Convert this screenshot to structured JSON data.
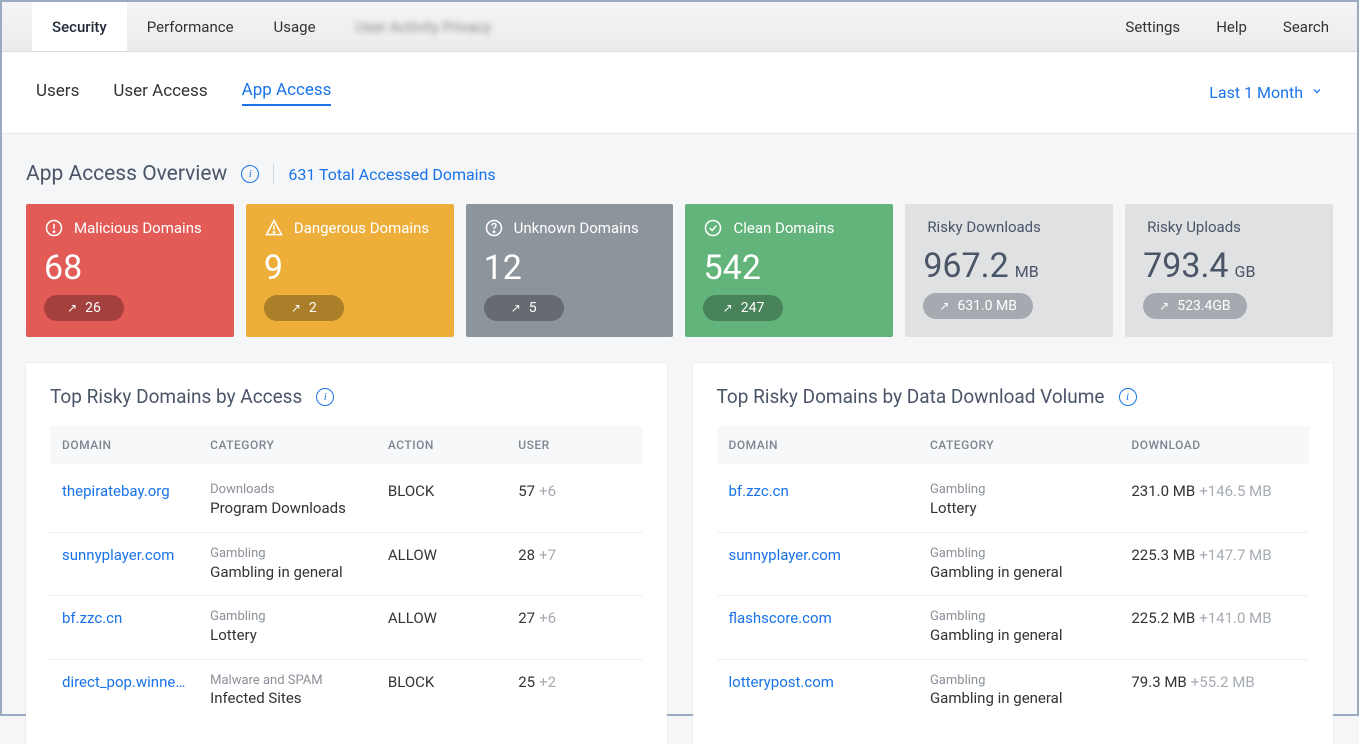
{
  "topbar": {
    "tabs": [
      "Security",
      "Performance",
      "Usage"
    ],
    "blurred_tab": "User Activity Privacy",
    "right": [
      "Settings",
      "Help",
      "Search"
    ]
  },
  "subnav": {
    "tabs": [
      "Users",
      "User Access",
      "App Access"
    ],
    "active_index": 2,
    "range": "Last 1 Month"
  },
  "overview": {
    "title": "App Access Overview",
    "summary": "631 Total Accessed Domains"
  },
  "cards": [
    {
      "label": "Malicious Domains",
      "value": "68",
      "delta": "26",
      "color": "red",
      "icon": "alert"
    },
    {
      "label": "Dangerous Domains",
      "value": "9",
      "delta": "2",
      "color": "orange",
      "icon": "warn"
    },
    {
      "label": "Unknown Domains",
      "value": "12",
      "delta": "5",
      "color": "gray",
      "icon": "question"
    },
    {
      "label": "Clean Domains",
      "value": "542",
      "delta": "247",
      "color": "green",
      "icon": "check"
    },
    {
      "label": "Risky Downloads",
      "value": "967.2",
      "unit": "MB",
      "delta": "631.0 MB",
      "color": "light"
    },
    {
      "label": "Risky Uploads",
      "value": "793.4",
      "unit": "GB",
      "delta": "523.4GB",
      "color": "light"
    }
  ],
  "panel1": {
    "title": "Top Risky Domains by Access",
    "headers": [
      "DOMAIN",
      "CATEGORY",
      "ACTION",
      "USER"
    ],
    "rows": [
      {
        "domain": "thepiratebay.org",
        "cat_top": "Downloads",
        "cat_bot": "Program Downloads",
        "action": "BLOCK",
        "user": "57",
        "delta": "+6"
      },
      {
        "domain": "sunnyplayer.com",
        "cat_top": "Gambling",
        "cat_bot": "Gambling in general",
        "action": "ALLOW",
        "user": "28",
        "delta": "+7"
      },
      {
        "domain": "bf.zzc.cn",
        "cat_top": "Gambling",
        "cat_bot": "Lottery",
        "action": "ALLOW",
        "user": "27",
        "delta": "+6"
      },
      {
        "domain": "direct_pop.winner...",
        "cat_top": "Malware and SPAM",
        "cat_bot": "Infected Sites",
        "action": "BLOCK",
        "user": "25",
        "delta": "+2"
      }
    ]
  },
  "panel2": {
    "title": "Top Risky Domains by Data Download Volume",
    "headers": [
      "DOMAIN",
      "CATEGORY",
      "DOWNLOAD"
    ],
    "rows": [
      {
        "domain": "bf.zzc.cn",
        "cat_top": "Gambling",
        "cat_bot": "Lottery",
        "dl": "231.0 MB",
        "delta": "+146.5 MB"
      },
      {
        "domain": "sunnyplayer.com",
        "cat_top": "Gambling",
        "cat_bot": "Gambling in general",
        "dl": "225.3 MB",
        "delta": "+147.7 MB"
      },
      {
        "domain": "flashscore.com",
        "cat_top": "Gambling",
        "cat_bot": "Gambling in general",
        "dl": "225.2 MB",
        "delta": "+141.0 MB"
      },
      {
        "domain": "lotterypost.com",
        "cat_top": "Gambling",
        "cat_bot": "Gambling in general",
        "dl": "79.3 MB",
        "delta": "+55.2 MB"
      }
    ]
  }
}
